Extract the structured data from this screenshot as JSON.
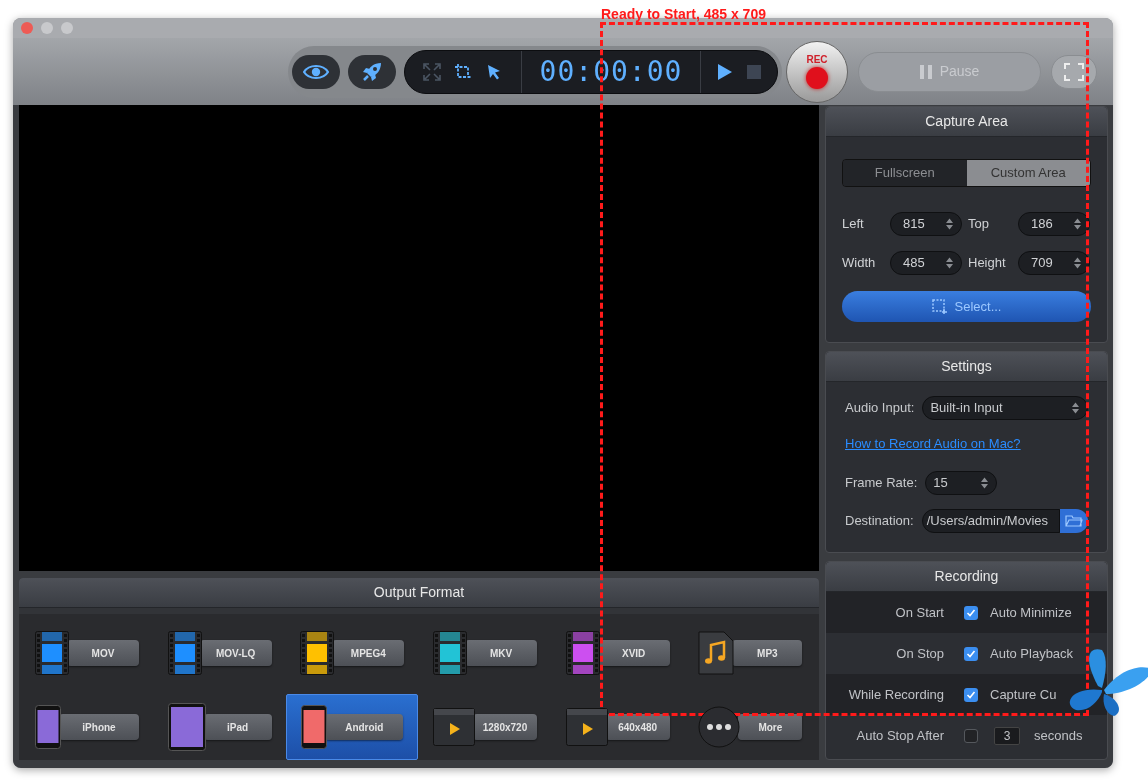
{
  "overlay": {
    "label": "Ready to Start, 485 x 709"
  },
  "toolbar": {
    "tools": [
      {
        "kind": "eye"
      },
      {
        "kind": "rocket"
      }
    ],
    "modes": [
      {
        "kind": "fullscreen",
        "disabled": true
      },
      {
        "kind": "region",
        "disabled": false
      },
      {
        "kind": "cursor",
        "disabled": false
      }
    ],
    "timer": "00:00:00",
    "rec": "REC",
    "pause": {
      "label": "Pause",
      "disabled": true
    }
  },
  "output_format": {
    "title": "Output Format",
    "formats": [
      {
        "label": "MOV",
        "kind": "film",
        "color": "#1e8fff",
        "selected": false
      },
      {
        "label": "MOV-LQ",
        "kind": "film",
        "color": "#1e8fff",
        "selected": false
      },
      {
        "label": "MPEG4",
        "kind": "film",
        "color": "#ffc000",
        "selected": false
      },
      {
        "label": "MKV",
        "kind": "film",
        "color": "#22c3d6",
        "selected": false
      },
      {
        "label": "XVID",
        "kind": "film",
        "color": "#cc4ff0",
        "selected": false
      },
      {
        "label": "MP3",
        "kind": "audio",
        "selected": false
      },
      {
        "label": "iPhone",
        "kind": "phone",
        "color": "#8a6ad8",
        "selected": false
      },
      {
        "label": "iPad",
        "kind": "tablet",
        "color": "#8a6ad8",
        "selected": false
      },
      {
        "label": "Android",
        "kind": "phone",
        "color": "#f06a6a",
        "selected": true
      },
      {
        "label": "1280x720",
        "kind": "video",
        "selected": false
      },
      {
        "label": "640x480",
        "kind": "video",
        "selected": false
      },
      {
        "label": "More",
        "kind": "more",
        "selected": false
      }
    ]
  },
  "capture_area": {
    "title": "Capture Area",
    "tabs": [
      {
        "label": "Fullscreen",
        "selected": false
      },
      {
        "label": "Custom Area",
        "selected": true
      }
    ],
    "fields": [
      {
        "label": "Left",
        "value": "815"
      },
      {
        "label": "Top",
        "value": "186"
      },
      {
        "label": "Width",
        "value": "485"
      },
      {
        "label": "Height",
        "value": "709"
      }
    ],
    "select_button": "Select..."
  },
  "settings": {
    "title": "Settings",
    "audio_input": {
      "label": "Audio Input:",
      "value": "Built-in Input"
    },
    "help_link": "How to Record Audio on Mac?",
    "frame_rate": {
      "label": "Frame Rate:",
      "value": "15"
    },
    "destination": {
      "label": "Destination:",
      "value": "/Users/admin/Movies"
    }
  },
  "recording": {
    "title": "Recording",
    "rows": [
      {
        "kind": "option",
        "label": "On Start",
        "option": "Auto Minimize",
        "checked": true
      },
      {
        "kind": "option",
        "label": "On Stop",
        "option": "Auto Playback",
        "checked": true
      },
      {
        "kind": "option",
        "label": "While Recording",
        "option": "Capture Cu",
        "checked": true
      },
      {
        "kind": "timer",
        "label": "Auto Stop After",
        "checked": false,
        "value": "3",
        "unit": "seconds"
      }
    ]
  }
}
